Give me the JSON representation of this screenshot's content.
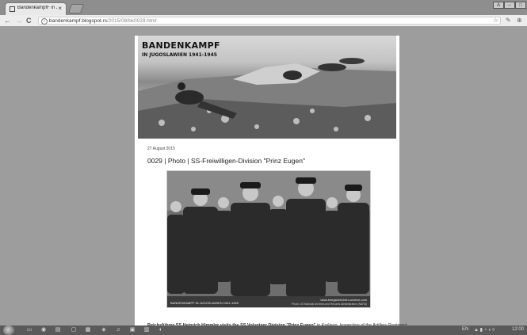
{
  "tab": {
    "title": "BandenkampfF in Jugoslav",
    "close": "×"
  },
  "window_controls": {
    "profile": "A",
    "minimize": "–",
    "maximize": "□"
  },
  "toolbar": {
    "back": "←",
    "forward": "→",
    "reload": "C",
    "info": "i",
    "url_host": "bandenkampf.blogspot.rs",
    "url_path": "/2015/08/bk0029.html",
    "star": "☆",
    "ext1": "✎",
    "ext2": "⊕"
  },
  "blog": {
    "banner_title": "BANDENKAMPF",
    "banner_subtitle": "IN JUGOSLAWIEN 1941-1945",
    "post_date": "27 August 2015",
    "post_title": "0029 | Photo | SS-Freiwilligen-Division \"Prinz Eugen\"",
    "photo_caption_left": "BANDENKAMPF IN JUGOSLAWIEN 1941-1945",
    "photo_caption_right": "www.kriegsberichter-archive.com",
    "photo_caption_right2": "Photo: US National Archives and Records Administration (NARA)",
    "caption_bold": "Reichsführer-SS Heinrich Himmler visits the SS Volunteer Division \"Prinz Eugen\"",
    "caption_rest": " in Kraljevo. Inspection of the Artillery Regiment."
  },
  "taskbar": {
    "items": [
      "▭",
      "◉",
      "▤",
      "▢",
      "▦",
      "◈",
      "♫",
      "▣",
      "▥",
      "◐"
    ],
    "tray_text": "EN",
    "tray_icons": "▲ ▮ ◔ ◖ ◊",
    "clock": "12:00"
  }
}
